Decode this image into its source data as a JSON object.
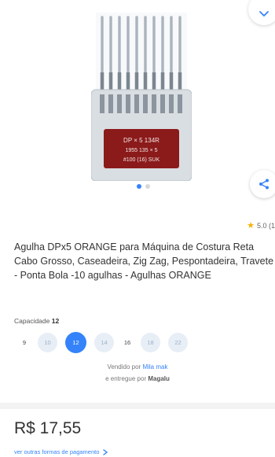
{
  "product": {
    "title": "Agulha DPx5 ORANGE para Máquina de Costura Reta Cabo Grosso, Caseadeira, Zig Zag, Pespontadeira, Travete - Ponta Bola -10 agulhas - Agulhas ORANGE",
    "rating": "5.0 (1",
    "image_label": {
      "line1": "DP × 5 134R",
      "line2": "1955  135 × 5",
      "line3": "#100 (16) SUK"
    }
  },
  "gallery": {
    "current_index": 1,
    "total": 2
  },
  "capacity": {
    "label": "Capacidade",
    "selected": "12",
    "options": [
      "9",
      "10",
      "12",
      "14",
      "16",
      "18",
      "22"
    ]
  },
  "seller": {
    "sold_by_prefix": "Vendido por",
    "seller_name": "Mila mak",
    "delivered_prefix": "e entregue por",
    "courier": "Magalu"
  },
  "price": {
    "value": "R$ 17,55"
  },
  "payment": {
    "link_label": "ver outras formas de pagamento"
  },
  "colors": {
    "accent": "#3483fa",
    "star": "#f5b400",
    "needle_label": "#8b1a1a"
  }
}
